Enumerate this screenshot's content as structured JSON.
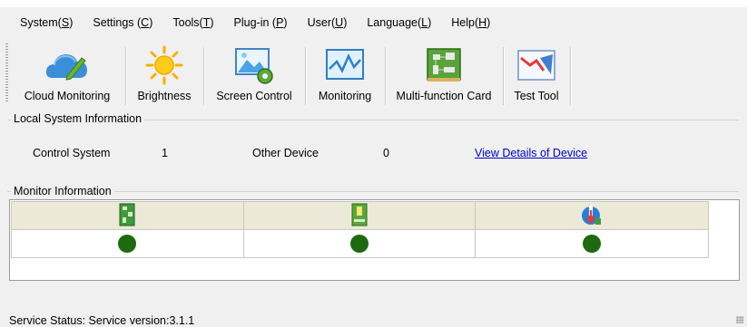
{
  "menu": [
    {
      "label": "System(",
      "key": "S",
      "tail": ")"
    },
    {
      "label": "Settings (",
      "key": "C",
      "tail": ")"
    },
    {
      "label": "Tools(",
      "key": "T",
      "tail": ")"
    },
    {
      "label": "Plug-in (",
      "key": "P",
      "tail": ")"
    },
    {
      "label": "User(",
      "key": "U",
      "tail": ")"
    },
    {
      "label": "Language(",
      "key": "L",
      "tail": ")"
    },
    {
      "label": "Help(",
      "key": "H",
      "tail": ")"
    }
  ],
  "toolbar": {
    "items": [
      {
        "label": "Cloud Monitoring",
        "icon": "cloud-edit-icon"
      },
      {
        "label": "Brightness",
        "icon": "sun-icon"
      },
      {
        "label": "Screen Control",
        "icon": "screen-gear-icon"
      },
      {
        "label": "Monitoring",
        "icon": "monitor-wave-icon"
      },
      {
        "label": "Multi-function Card",
        "icon": "circuit-board-icon"
      },
      {
        "label": "Test Tool",
        "icon": "chart-test-icon"
      }
    ]
  },
  "local_info": {
    "title": "Local System Information",
    "control_system_label": "Control System",
    "control_system_value": "1",
    "other_device_label": "Other Device",
    "other_device_value": "0",
    "details_link": "View Details of Device"
  },
  "monitor": {
    "title": "Monitor Information",
    "columns": [
      {
        "icon": "sending-card-icon",
        "status": "ok"
      },
      {
        "icon": "receiving-card-icon",
        "status": "ok"
      },
      {
        "icon": "thermometer-icon",
        "status": "ok"
      }
    ],
    "status_color": "#1e6a0f"
  },
  "status_bar": {
    "text": "Service Status:  Service version:3.1.1"
  }
}
